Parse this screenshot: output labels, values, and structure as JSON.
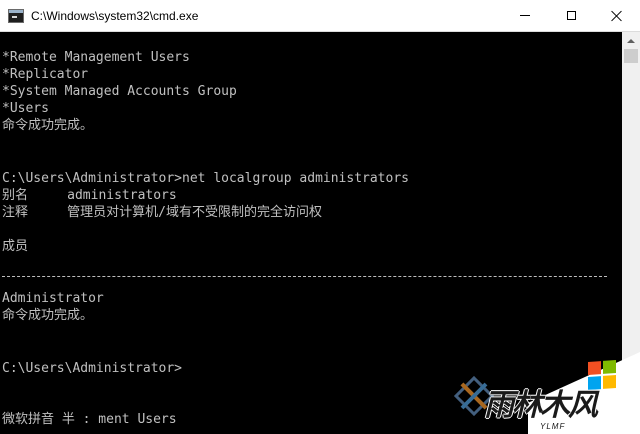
{
  "window": {
    "title": "C:\\Windows\\system32\\cmd.exe",
    "icon": "cmd-icon"
  },
  "console": {
    "lines": [
      "*Remote Management Users",
      "*Replicator",
      "*System Managed Accounts Group",
      "*Users",
      "命令成功完成。",
      "",
      "",
      "C:\\Users\\Administrator>net localgroup administrators",
      "别名     administrators",
      "注释     管理员对计算机/域有不受限制的完全访问权",
      "",
      "成员",
      "",
      "",
      "Administrator",
      "命令成功完成。",
      "",
      "",
      "C:\\Users\\Administrator>",
      "",
      "",
      "微软拼音 半 : ment Users"
    ]
  },
  "watermark": {
    "logo_text": "雨林木风",
    "sub_text": "YLMF"
  },
  "colors": {
    "console_bg": "#000000",
    "console_fg": "#c0c0c0",
    "titlebar_bg": "#ffffff"
  }
}
